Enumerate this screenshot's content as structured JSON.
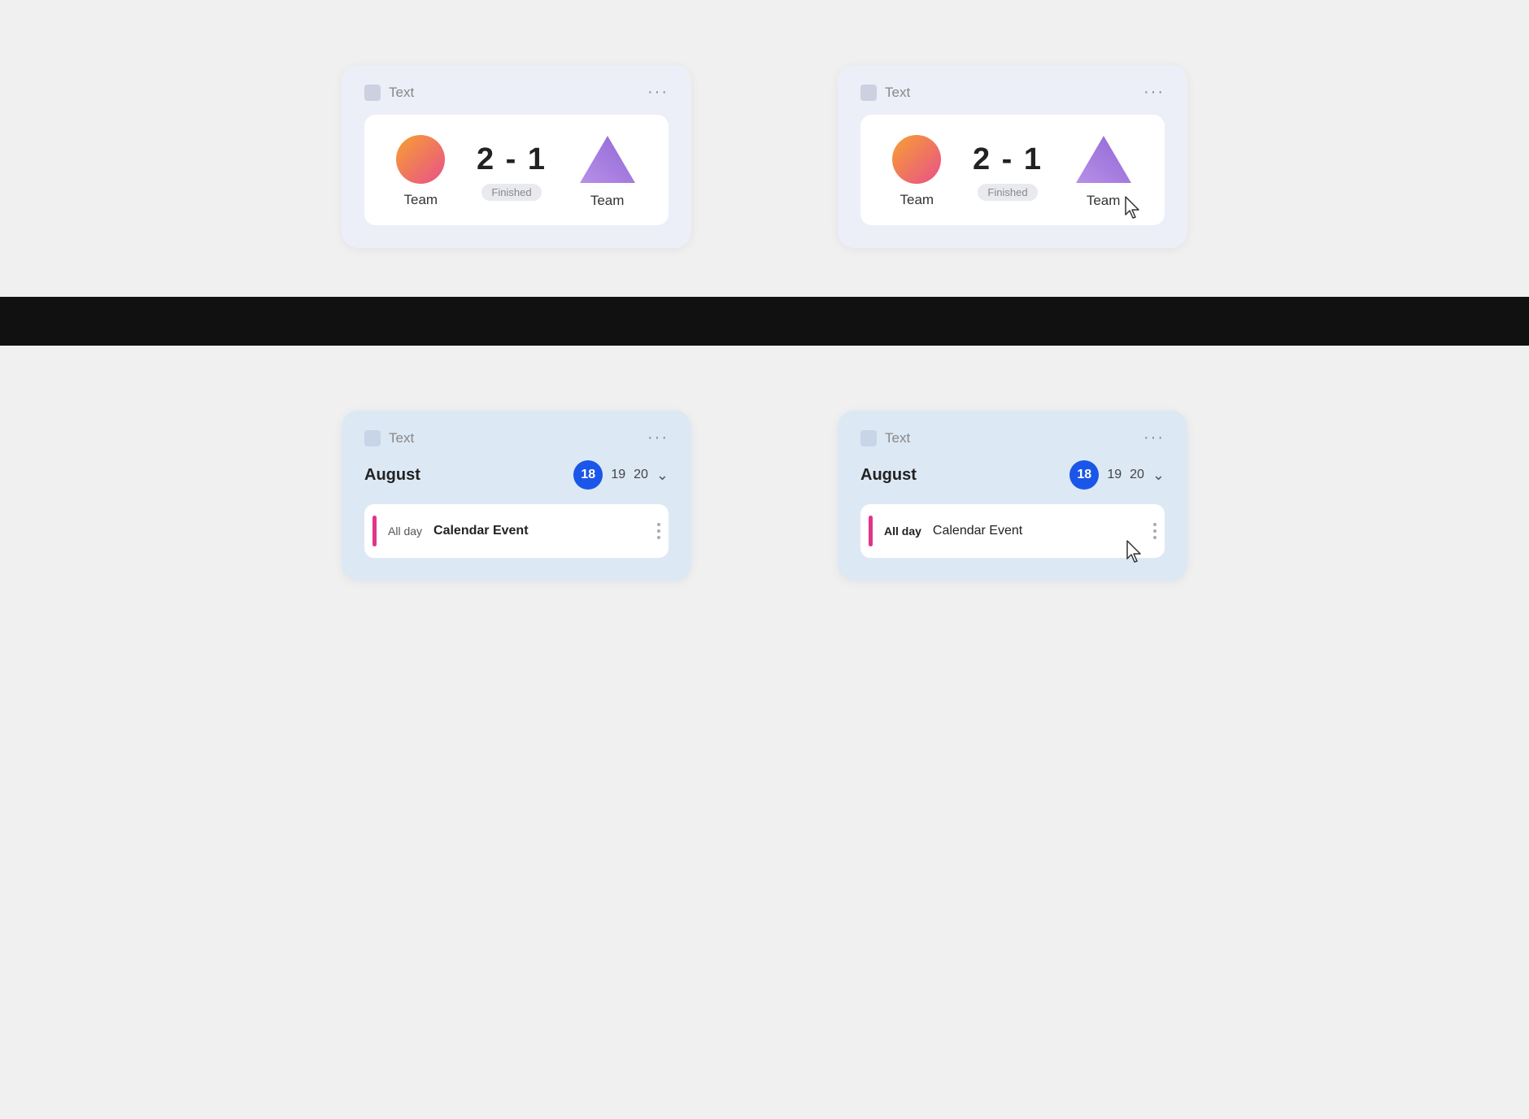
{
  "cards": {
    "score_card_left": {
      "title": "Text",
      "menu": "···",
      "team1": "Team",
      "team2": "Team",
      "score": "2 - 1",
      "status": "Finished"
    },
    "score_card_right": {
      "title": "Text",
      "menu": "···",
      "team1": "Team",
      "team2": "Team",
      "score": "2 - 1",
      "status": "Finished"
    },
    "calendar_card_left": {
      "title": "Text",
      "menu": "···",
      "month": "August",
      "dates": [
        "18",
        "19",
        "20"
      ],
      "active_date": "18",
      "chevron": "˅",
      "event_allday": "All day",
      "event_name": "Calendar Event"
    },
    "calendar_card_right": {
      "title": "Text",
      "menu": "···",
      "month": "August",
      "dates": [
        "18",
        "19",
        "20"
      ],
      "active_date": "18",
      "chevron": "˅",
      "event_allday": "All day",
      "event_name": "Calendar Event"
    }
  }
}
